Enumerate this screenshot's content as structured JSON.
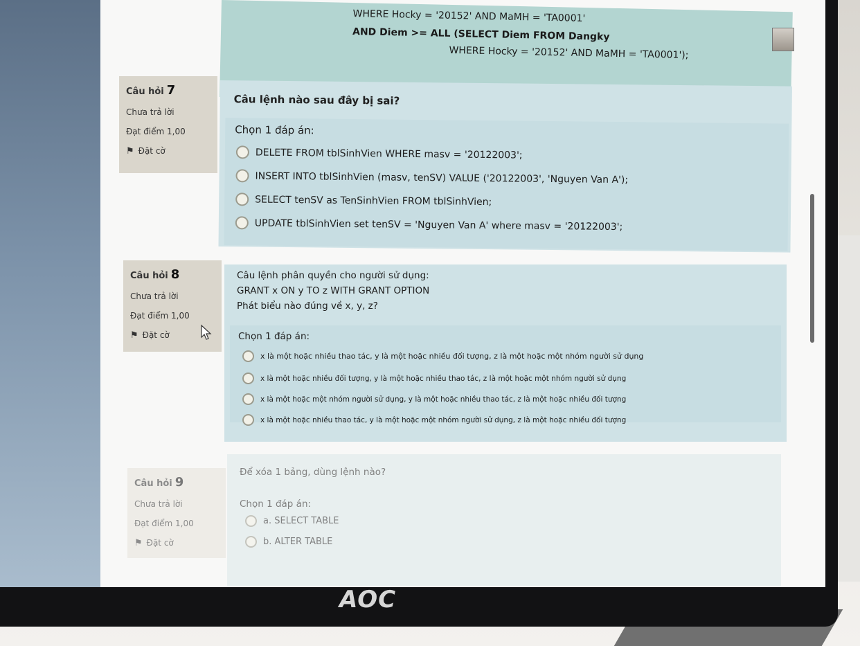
{
  "previous_question": {
    "line1": "WHERE Hocky = '20152' AND MaMH = 'TA0001'",
    "line2": "AND Diem >= ALL (SELECT Diem FROM Dangky",
    "line3": "WHERE Hocky = '20152' AND MaMH = 'TA0001');"
  },
  "questions": [
    {
      "label": "Câu hỏi",
      "number": "7",
      "status": "Chưa trả lời",
      "score": "Đạt điểm 1,00",
      "flag": "Đặt cờ",
      "text_lines": [
        "Câu lệnh nào sau đây bị sai?"
      ],
      "prompt": "Chọn 1 đáp án:",
      "options": [
        "DELETE FROM tblSinhVien WHERE masv = '20122003';",
        "INSERT INTO tblSinhVien (masv, tenSV) VALUE ('20122003', 'Nguyen Van A');",
        "SELECT tenSV as TenSinhVien FROM tblSinhVien;",
        "UPDATE tblSinhVien set tenSV = 'Nguyen Van A' where masv = '20122003';"
      ]
    },
    {
      "label": "Câu hỏi",
      "number": "8",
      "status": "Chưa trả lời",
      "score": "Đạt điểm 1,00",
      "flag": "Đặt cờ",
      "text_lines": [
        "Câu lệnh phân quyền cho người sử dụng:",
        "GRANT x ON y TO z WITH GRANT OPTION",
        "Phát biểu nào đúng về x, y, z?"
      ],
      "prompt": "Chọn 1 đáp án:",
      "options": [
        "x là một hoặc nhiều thao tác, y là một hoặc nhiều đối tượng, z là một hoặc một nhóm người sử dụng",
        "x là một hoặc nhiều đối tượng, y là một hoặc nhiều thao tác, z là một hoặc một nhóm người sử dụng",
        "x là một hoặc một nhóm người sử dụng, y là một hoặc nhiều thao tác, z là một hoặc nhiều đối tượng",
        "x là một hoặc nhiều thao tác, y là một hoặc một nhóm người sử dụng, z là một hoặc nhiều đối tượng"
      ]
    },
    {
      "label": "Câu hỏi",
      "number": "9",
      "status": "Chưa trả lời",
      "score": "Đạt điểm 1,00",
      "flag": "Đặt cờ",
      "text_lines": [
        "Để xóa 1 bảng, dùng lệnh nào?"
      ],
      "prompt": "Chọn 1 đáp án:",
      "options": [
        "a. SELECT TABLE",
        "b. ALTER TABLE"
      ]
    }
  ],
  "monitor_brand": "AOC",
  "colors": {
    "question_bg": "#cfe2e6",
    "info_bg": "#dad6cc",
    "sidebar": "#6f849a",
    "bezel": "#121214"
  }
}
